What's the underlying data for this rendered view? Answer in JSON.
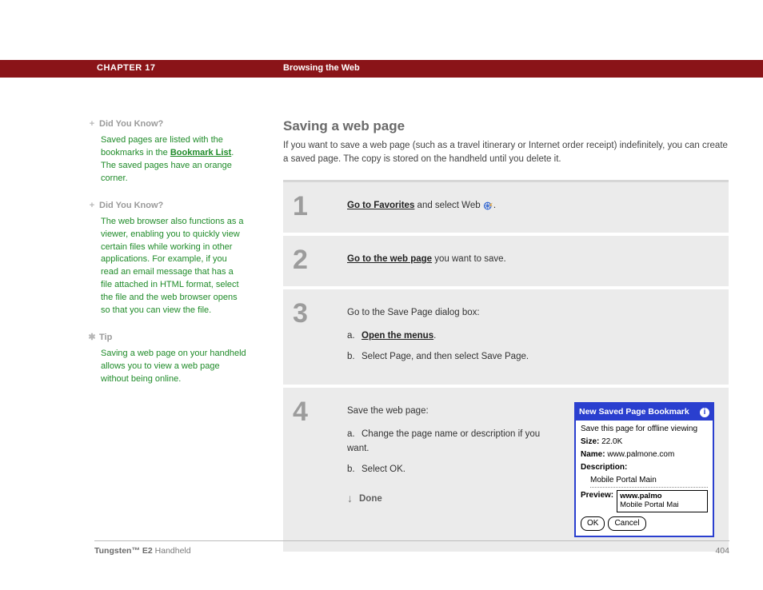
{
  "header": {
    "chapter": "CHAPTER 17",
    "title": "Browsing the Web"
  },
  "sidebar": {
    "notes": [
      {
        "symbol": "+",
        "head": "Did You Know?",
        "pre": "Saved pages are listed with the bookmarks in the ",
        "link": "Bookmark List",
        "post": ". The saved pages have an orange corner."
      },
      {
        "symbol": "+",
        "head": "Did You Know?",
        "body": "The web browser also functions as a viewer, enabling you to quickly view certain files while working in other applications. For example, if you read an email message that has a file attached in HTML format, select the file and the web browser opens so that you can view the file."
      },
      {
        "symbol": "✱",
        "head": "Tip",
        "body": "Saving a web page on your handheld allows you to view a web page without being online."
      }
    ]
  },
  "main": {
    "heading": "Saving a web page",
    "intro": "If you want to save a web page (such as a travel itinerary or Internet order receipt) indefinitely, you can create a saved page. The copy is stored on the handheld until you delete it.",
    "steps": [
      {
        "num": "1",
        "link": "Go to Favorites",
        "after": " and select Web "
      },
      {
        "num": "2",
        "link": "Go to the web page",
        "after": " you want to save."
      },
      {
        "num": "3",
        "lead": "Go to the Save Page dialog box:",
        "subs": [
          {
            "letter": "a.",
            "link": "Open the menus",
            "after": "."
          },
          {
            "letter": "b.",
            "text": "Select Page, and then select Save Page."
          }
        ]
      },
      {
        "num": "4",
        "lead": "Save the web page:",
        "subs": [
          {
            "letter": "a.",
            "text": "Change the page name or description if you want."
          },
          {
            "letter": "b.",
            "text": "Select OK."
          }
        ],
        "done": "Done"
      }
    ]
  },
  "dialog": {
    "title": "New Saved Page Bookmark",
    "line1": "Save this page for offline viewing",
    "size_label": "Size:",
    "size": "22.0K",
    "name_label": "Name:",
    "name": "www.palmone.com",
    "desc_label": "Description:",
    "desc": "Mobile Portal Main",
    "preview_label": "Preview:",
    "preview1": "www.palmo",
    "preview2": "Mobile Portal Mai",
    "ok": "OK",
    "cancel": "Cancel"
  },
  "footer": {
    "product_bold": "Tungsten™ E2",
    "product_rest": " Handheld",
    "page": "404"
  }
}
